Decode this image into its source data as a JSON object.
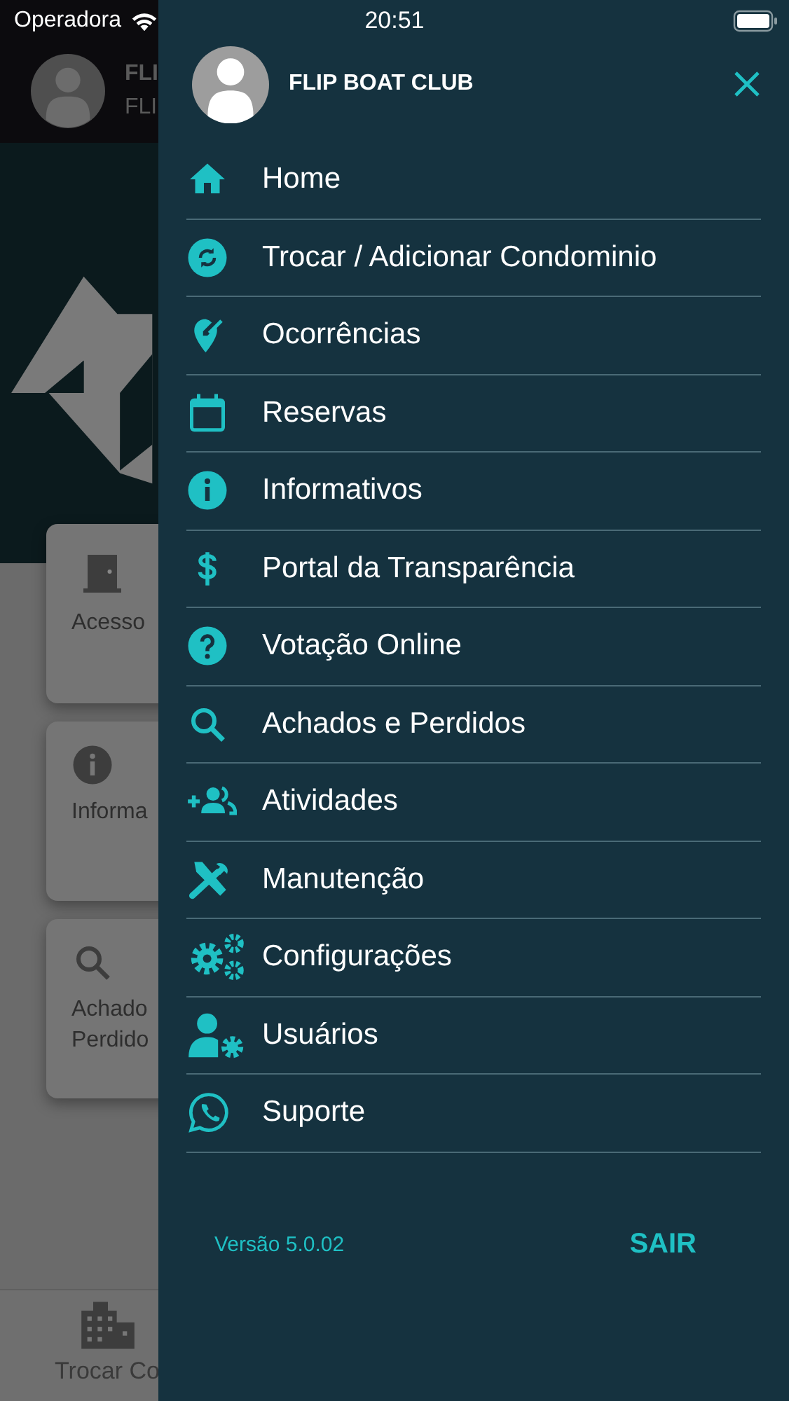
{
  "status_bar": {
    "carrier": "Operadora",
    "time": "20:51"
  },
  "background": {
    "header_lines": [
      "FLI",
      "FLI"
    ],
    "cards": [
      {
        "lines": [
          "Acesso"
        ]
      },
      {
        "lines": [
          "Informa"
        ]
      },
      {
        "lines": [
          "Achado",
          "Perdido"
        ]
      }
    ],
    "tab_bar": {
      "label": "Trocar Co"
    }
  },
  "drawer": {
    "title": "FLIP BOAT CLUB",
    "items": [
      {
        "label": "Home"
      },
      {
        "label": "Trocar / Adicionar Condominio"
      },
      {
        "label": "Ocorrências"
      },
      {
        "label": "Reservas"
      },
      {
        "label": "Informativos"
      },
      {
        "label": "Portal da Transparência"
      },
      {
        "label": "Votação Online"
      },
      {
        "label": "Achados e Perdidos"
      },
      {
        "label": "Atividades"
      },
      {
        "label": "Manutenção"
      },
      {
        "label": "Configurações"
      },
      {
        "label": "Usuários"
      },
      {
        "label": "Suporte"
      }
    ],
    "version": "Versão 5.0.02",
    "logout": "SAIR"
  }
}
